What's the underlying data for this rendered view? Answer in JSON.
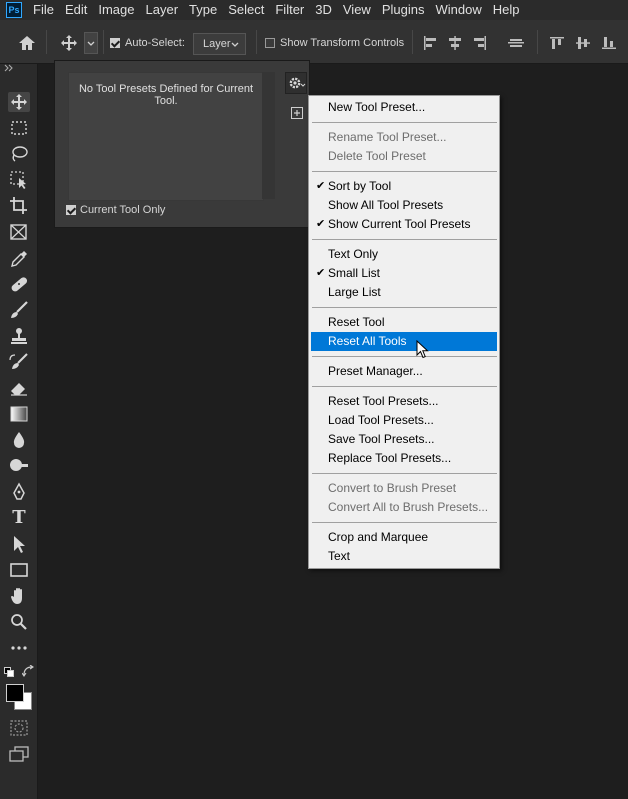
{
  "app": {
    "logo": "Ps"
  },
  "menubar": {
    "items": [
      "File",
      "Edit",
      "Image",
      "Layer",
      "Type",
      "Select",
      "Filter",
      "3D",
      "View",
      "Plugins",
      "Window",
      "Help"
    ]
  },
  "options": {
    "auto_select_label": "Auto-Select:",
    "auto_select_checked": true,
    "auto_select_target": "Layer",
    "show_transform_label": "Show Transform Controls",
    "show_transform_checked": false
  },
  "preset_panel": {
    "empty_message": "No Tool Presets Defined for Current Tool.",
    "current_tool_only_label": "Current Tool Only",
    "current_tool_only_checked": true
  },
  "context_menu": {
    "items": [
      {
        "label": "New Tool Preset...",
        "disabled": false,
        "checked": false
      },
      {
        "label": "Rename Tool Preset...",
        "disabled": true,
        "checked": false
      },
      {
        "label": "Delete Tool Preset",
        "disabled": true,
        "checked": false
      },
      {
        "label": "Sort by Tool",
        "disabled": false,
        "checked": true
      },
      {
        "label": "Show All Tool Presets",
        "disabled": false,
        "checked": false
      },
      {
        "label": "Show Current Tool Presets",
        "disabled": false,
        "checked": true
      },
      {
        "label": "Text Only",
        "disabled": false,
        "checked": false
      },
      {
        "label": "Small List",
        "disabled": false,
        "checked": true
      },
      {
        "label": "Large List",
        "disabled": false,
        "checked": false
      },
      {
        "label": "Reset Tool",
        "disabled": false,
        "checked": false
      },
      {
        "label": "Reset All Tools",
        "disabled": false,
        "checked": false,
        "highlighted": true
      },
      {
        "label": "Preset Manager...",
        "disabled": false,
        "checked": false
      },
      {
        "label": "Reset Tool Presets...",
        "disabled": false,
        "checked": false
      },
      {
        "label": "Load Tool Presets...",
        "disabled": false,
        "checked": false
      },
      {
        "label": "Save Tool Presets...",
        "disabled": false,
        "checked": false
      },
      {
        "label": "Replace Tool Presets...",
        "disabled": false,
        "checked": false
      },
      {
        "label": "Convert to Brush Preset",
        "disabled": true,
        "checked": false
      },
      {
        "label": "Convert All to Brush Presets...",
        "disabled": true,
        "checked": false
      },
      {
        "label": "Crop and Marquee",
        "disabled": false,
        "checked": false
      },
      {
        "label": "Text",
        "disabled": false,
        "checked": false
      }
    ],
    "check_glyph": "✔"
  },
  "colors": {
    "highlight": "#0078d7",
    "canvas_bg": "#1e1e1e",
    "panel_bg": "#3a3a3a"
  },
  "toolbar": {
    "tools": [
      "move-tool-icon",
      "marquee-tool-icon",
      "lasso-tool-icon",
      "object-select-tool-icon",
      "crop-tool-icon",
      "frame-tool-icon",
      "eyedropper-tool-icon",
      "healing-brush-icon",
      "brush-tool-icon",
      "clone-stamp-icon",
      "history-brush-icon",
      "eraser-tool-icon",
      "gradient-tool-icon",
      "blur-tool-icon",
      "dodge-tool-icon",
      "pen-tool-icon",
      "type-tool-icon",
      "path-select-icon",
      "rectangle-tool-icon",
      "hand-tool-icon",
      "zoom-tool-icon",
      "more-tools-icon"
    ],
    "type_glyph": "T"
  }
}
